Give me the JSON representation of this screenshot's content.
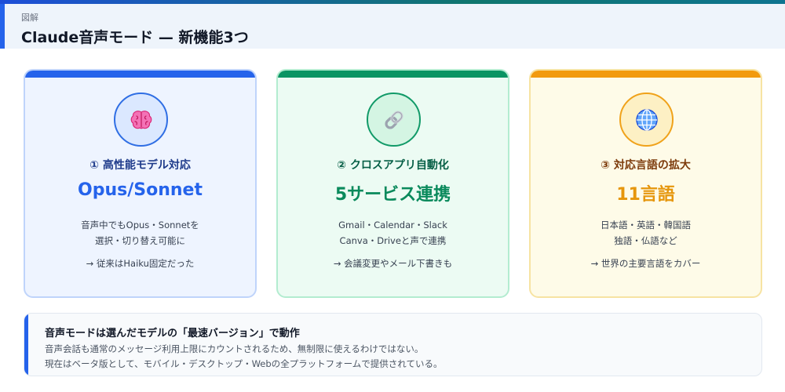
{
  "header": {
    "eyebrow": "図解",
    "title": "Claude音声モード — 新機能3つ"
  },
  "cards": [
    {
      "icon": "brain-icon",
      "heading": "① 高性能モデル対応",
      "metric": "Opus/Sonnet",
      "desc": [
        "音声中でもOpus・Sonnetを",
        "選択・切り替え可能に"
      ],
      "note": "→ 従来はHaiku固定だった",
      "accent": "#2563eb"
    },
    {
      "icon": "link-icon",
      "heading": "② クロスアプリ自動化",
      "metric": "5サービス連携",
      "desc": [
        "Gmail・Calendar・Slack",
        "Canva・Driveと声で連携"
      ],
      "note": "→ 会議変更やメール下書きも",
      "accent": "#0a9463"
    },
    {
      "icon": "globe-icon",
      "heading": "③ 対応言語の拡大",
      "metric": "11言語",
      "desc": [
        "日本語・英語・韓国語",
        "独語・仏語など"
      ],
      "note": "→ 世界の主要言語をカバー",
      "accent": "#f29a0e"
    }
  ],
  "info": {
    "title": "音声モードは選んだモデルの「最速バージョン」で動作",
    "lines": [
      "音声会話も通常のメッセージ利用上限にカウントされるため、無制限に使えるわけではない。",
      "現在はベータ版として、モバイル・デスクトップ・Webの全プラットフォームで提供されている。"
    ]
  }
}
